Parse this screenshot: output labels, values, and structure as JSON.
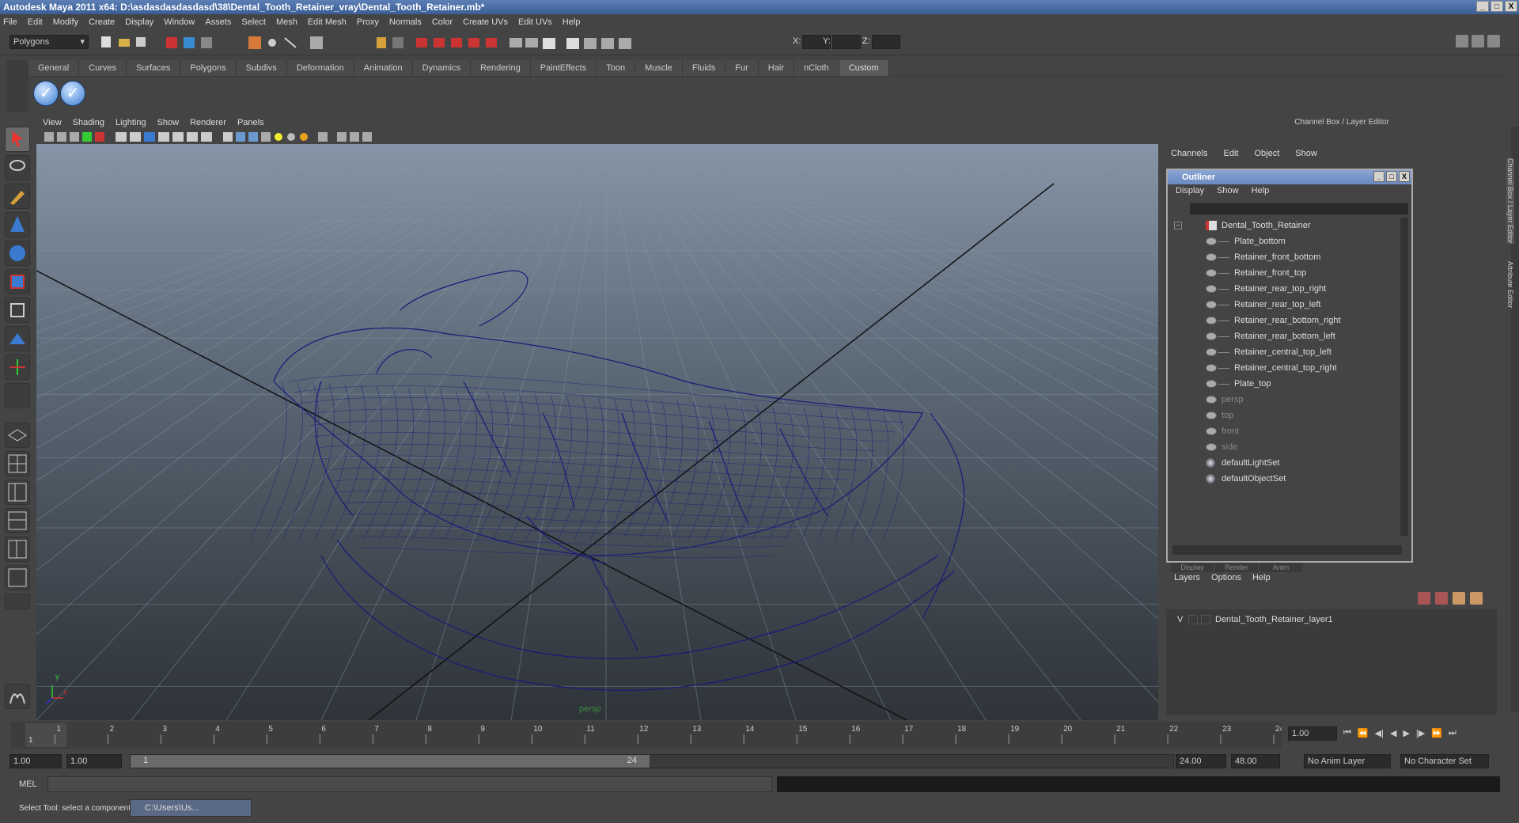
{
  "window": {
    "title": "Autodesk Maya 2011 x64: D:\\asdasdasdasdasd\\38\\Dental_Tooth_Retainer_vray\\Dental_Tooth_Retainer.mb*",
    "controls": [
      "_",
      "□",
      "X"
    ]
  },
  "menubar": [
    "File",
    "Edit",
    "Modify",
    "Create",
    "Display",
    "Window",
    "Assets",
    "Select",
    "Mesh",
    "Edit Mesh",
    "Proxy",
    "Normals",
    "Color",
    "Create UVs",
    "Edit UVs",
    "Help"
  ],
  "statusline": {
    "mode": "Polygons",
    "x_label": "X:",
    "y_label": "Y:",
    "z_label": "Z:"
  },
  "shelf": {
    "tabs": [
      "General",
      "Curves",
      "Surfaces",
      "Polygons",
      "Subdivs",
      "Deformation",
      "Animation",
      "Dynamics",
      "Rendering",
      "PaintEffects",
      "Toon",
      "Muscle",
      "Fluids",
      "Fur",
      "Hair",
      "nCloth",
      "Custom"
    ],
    "active_tab": "Custom",
    "buttons": [
      "check-icon",
      "check-icon"
    ]
  },
  "viewport": {
    "menu": [
      "View",
      "Shading",
      "Lighting",
      "Show",
      "Renderer",
      "Panels"
    ],
    "camera_label": "persp",
    "axis_y": "y",
    "axis_x": "x",
    "wire_color": "#1a1a7a"
  },
  "channelbox": {
    "title": "Channel Box / Layer Editor",
    "menu": [
      "Channels",
      "Edit",
      "Object",
      "Show"
    ],
    "side_tabs": [
      "Channel Box / Layer Editor",
      "Attribute Editor"
    ]
  },
  "outliner": {
    "title": "Outliner",
    "menu": [
      "Display",
      "Show",
      "Help"
    ],
    "root": "Dental_Tooth_Retainer",
    "children": [
      "Plate_bottom",
      "Retainer_front_bottom",
      "Retainer_front_top",
      "Retainer_rear_top_right",
      "Retainer_rear_top_left",
      "Retainer_rear_bottom_right",
      "Retainer_rear_bottom_left",
      "Retainer_central_top_left",
      "Retainer_central_top_right",
      "Plate_top"
    ],
    "cameras": [
      "persp",
      "top",
      "front",
      "side"
    ],
    "sets": [
      "defaultLightSet",
      "defaultObjectSet"
    ]
  },
  "layers": {
    "tabs": [
      "Display",
      "Render",
      "Anim"
    ],
    "menu": [
      "Layers",
      "Options",
      "Help"
    ],
    "rows": [
      {
        "visible": "V",
        "name": "Dental_Tooth_Retainer_layer1"
      }
    ]
  },
  "timeline": {
    "ticks": [
      "1",
      "2",
      "3",
      "4",
      "5",
      "6",
      "7",
      "8",
      "9",
      "10",
      "11",
      "12",
      "13",
      "14",
      "15",
      "16",
      "17",
      "18",
      "19",
      "20",
      "21",
      "22",
      "23",
      "24"
    ],
    "current_frame": "1.00",
    "current_marker": "1"
  },
  "range": {
    "start": "1.00",
    "start2": "1.00",
    "range_start": "1",
    "range_end": "24",
    "end": "24.00",
    "end2": "48.00",
    "anim_layer": "No Anim Layer",
    "char_set": "No Character Set"
  },
  "cmdline": {
    "label": "MEL"
  },
  "helpline": {
    "text": "Select Tool: select a component",
    "task_label": "C:\\Users\\Us..."
  }
}
